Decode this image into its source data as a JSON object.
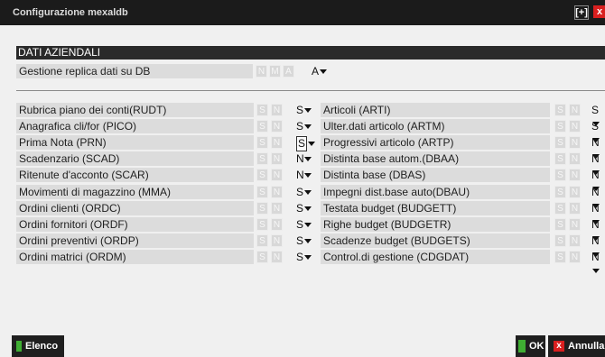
{
  "window": {
    "title": "Configurazione mexaldb",
    "maximize_glyph": "[+]",
    "close_glyph": "x"
  },
  "section": {
    "title": "DATI AZIENDALI"
  },
  "replica": {
    "label": "Gestione replica dati su DB",
    "flags": [
      "N",
      "M",
      "A"
    ],
    "value": "A"
  },
  "flag_letters": [
    "S",
    "N"
  ],
  "left_rows": [
    {
      "label": "Rubrica piano dei conti(RUDT)",
      "value": "S"
    },
    {
      "label": "Anagrafica cli/for (PICO)",
      "value": "S"
    },
    {
      "label": "Prima Nota (PRN)",
      "value": "S"
    },
    {
      "label": "Scadenzario (SCAD)",
      "value": "N"
    },
    {
      "label": "Ritenute d'acconto (SCAR)",
      "value": "N"
    },
    {
      "label": "Movimenti di magazzino (MMA)",
      "value": "S"
    },
    {
      "label": "Ordini clienti (ORDC)",
      "value": "S"
    },
    {
      "label": "Ordini fornitori (ORDF)",
      "value": "S"
    },
    {
      "label": "Ordini preventivi (ORDP)",
      "value": "S"
    },
    {
      "label": "Ordini matrici (ORDM)",
      "value": "S"
    }
  ],
  "right_rows": [
    {
      "label": "Articoli (ARTI)",
      "value": "S"
    },
    {
      "label": "Ulter.dati articolo (ARTM)",
      "value": "S"
    },
    {
      "label": "Progressivi articolo (ARTP)",
      "value": "N"
    },
    {
      "label": "Distinta base autom.(DBAA)",
      "value": "N"
    },
    {
      "label": "Distinta base (DBAS)",
      "value": "N"
    },
    {
      "label": "Impegni dist.base auto(DBAU)",
      "value": "N"
    },
    {
      "label": "Testata budget (BUDGETT)",
      "value": "N"
    },
    {
      "label": "Righe budget (BUDGETR)",
      "value": "N"
    },
    {
      "label": "Scadenze budget (BUDGETS)",
      "value": "N"
    },
    {
      "label": "Control.di gestione (CDGDAT)",
      "value": "N"
    }
  ],
  "buttons": {
    "elenco": "Elenco",
    "ok": "OK",
    "annulla": "Annulla",
    "annulla_icon": "x"
  },
  "colors": {
    "title_bar": "#1b1b1b",
    "section_header": "#2a2a2a",
    "label_bg": "#dcdcdc",
    "ok_green": "#3fae33",
    "cancel_red": "#d91f1f"
  }
}
